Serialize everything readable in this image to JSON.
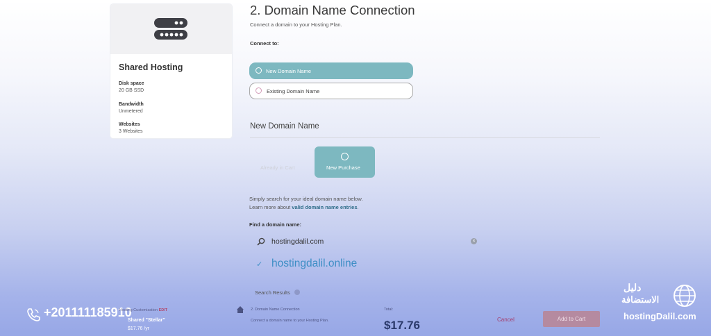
{
  "plan": {
    "title": "Shared Hosting",
    "specs": [
      {
        "label": "Disk space",
        "value": "20 GB SSD"
      },
      {
        "label": "Bandwidth",
        "value": "Unmetered"
      },
      {
        "label": "Websites",
        "value": "3 Websites"
      }
    ]
  },
  "main": {
    "heading": "2. Domain Name Connection",
    "subheading": "Connect a domain to your Hosting Plan.",
    "connect_label": "Connect to:",
    "options": [
      {
        "label": "New Domain Name",
        "selected": true
      },
      {
        "label": "Existing Domain Name",
        "selected": false
      }
    ],
    "section_title": "New Domain Name",
    "tabs": [
      {
        "label": "Already in Cart",
        "active": false
      },
      {
        "label": "New Purchase",
        "active": true
      }
    ],
    "help_line1": "Simply search for your ideal domain name below.",
    "help_line2_prefix": "Learn more about ",
    "help_link": "valid domain name entries",
    "help_line2_suffix": ".",
    "find_label": "Find a domain name:",
    "search_value": "hostingdalil.com",
    "result_domain": "hostingdalil.online",
    "search_results_label": "Search Results"
  },
  "bottom": {
    "customization": "Hosting Customization",
    "customization_edit": "EDIT",
    "plan_name": "Shared \"Stellar\"",
    "plan_price": "$17.76 /yr",
    "step_title": "2. Domain Name Connection",
    "step_desc": "Connect a domain name to your Hosting Plan.",
    "total_label": "Total:",
    "total_value": "$17.76",
    "cancel": "Cancel",
    "add_to_cart": "Add to Cart"
  },
  "watermark": {
    "phone": "+201111185910",
    "brand_arabic_top": "دليل",
    "brand_arabic": "الاستضافة",
    "site": "hostingDalil.com"
  },
  "colors": {
    "accent_teal": "#7db8c0",
    "link_blue": "#3d8ec5",
    "cancel_magenta": "#a33e6e",
    "add_button": "#b58aa0"
  }
}
